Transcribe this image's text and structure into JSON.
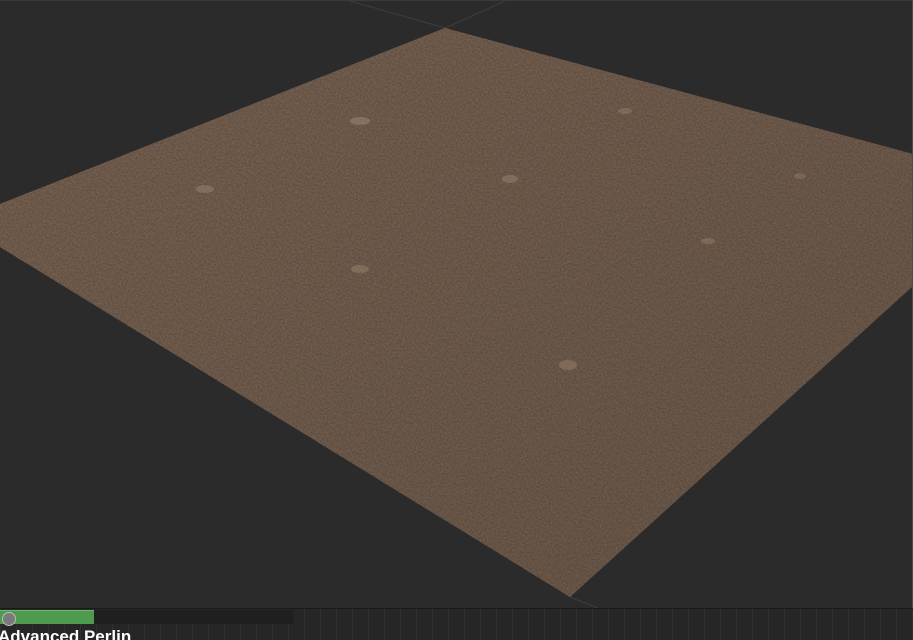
{
  "viewport": {
    "background_color": "#2b2b2b",
    "surface_color": "#6b5444",
    "surface_texture": "gravel-dirt"
  },
  "bottom_panel": {
    "progress": 0.32,
    "progress_color": "#4e9a4e",
    "node_title": "Advanced Perlin"
  }
}
